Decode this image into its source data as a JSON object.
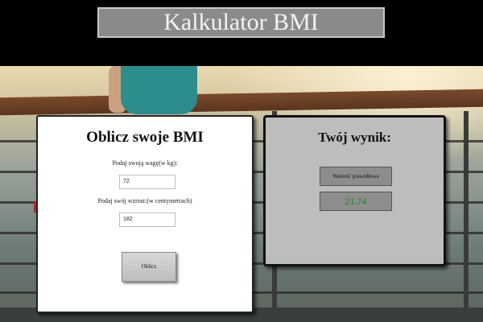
{
  "header": {
    "title": "Kalkulator BMI"
  },
  "form": {
    "heading": "Oblicz swoje BMI",
    "weight_label": "Podaj swoją wagę(w kg):",
    "weight_value": "72",
    "height_label": "Podaj swój wzrost:(w centymetrach)",
    "height_value": "182",
    "submit_label": "Oblicz"
  },
  "result": {
    "heading": "Twój wynik:",
    "status_text": "Wartość prawidłowa",
    "bmi_value": "21.74",
    "value_color": "#1d8a1d"
  }
}
